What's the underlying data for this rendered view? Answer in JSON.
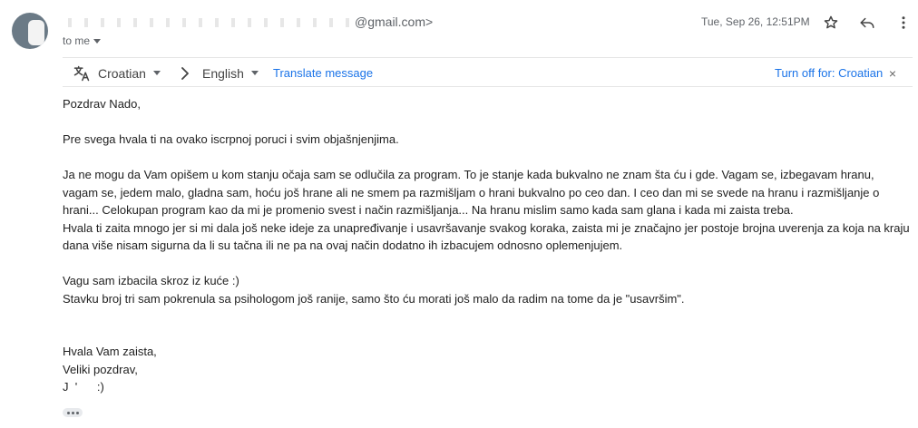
{
  "header": {
    "sender_suffix": "@gmail.com>",
    "recipient_label": "to me",
    "date": "Tue, Sep 26, 12:51PM"
  },
  "actions": {
    "star_icon": "star-icon",
    "reply_icon": "reply-icon",
    "more_icon": "more-vert-icon"
  },
  "translate_bar": {
    "source_language": "Croatian",
    "target_language": "English",
    "translate_link": "Translate message",
    "turn_off": "Turn off for: Croatian",
    "close_glyph": "×"
  },
  "email_body": {
    "greeting": "Pozdrav Nado,",
    "para1": "Pre svega hvala ti na ovako iscrpnoj poruci i svim objašnjenjima.",
    "para2_lines": [
      "Ja ne mogu da Vam opišem u kom stanju očaja sam se odlučila za program. To je stanje kada bukvalno ne znam šta ću i gde. Vagam se, izbegavam hranu,",
      "vagam se, jedem malo, gladna sam, hoću još hrane ali ne smem pa razmišljam o hrani bukvalno po ceo dan. I ceo dan mi se svede na hranu i razmišljanje o",
      "hrani... Celokupan program kao da mi je promenio svest i način razmišljanja... Na hranu mislim samo kada sam glana i kada mi zaista treba.",
      "Hvala ti zaita mnogo jer si mi dala još neke ideje za unapređivanje i usavršavanje svakog koraka, zaista mi je značajno jer postoje brojna uverenja za koja na kraju",
      "dana više nisam sigurna da li su tačna ili ne pa na ovaj način dodatno ih izbacujem odnosno oplemenjujem."
    ],
    "para3_lines": [
      "Vagu sam izbacila skroz iz kuće :)",
      "Stavku broj tri sam pokrenula sa psihologom još ranije, samo što ću morati još malo da radim na tome da je \"usavršim\"."
    ],
    "closing_lines": [
      "Hvala Vam zaista,",
      "Veliki pozdrav,",
      "J  '      :)"
    ]
  },
  "colors": {
    "link": "#1a73e8",
    "muted": "#5f6368",
    "text": "#222222"
  }
}
